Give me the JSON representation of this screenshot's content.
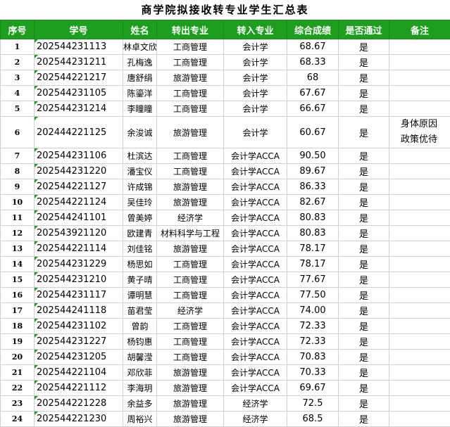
{
  "title": "商学院拟接收转专业学生汇总表",
  "headers": [
    "序号",
    "学号",
    "姓名",
    "转出专业",
    "转入专业",
    "综合成绩",
    "是否通过",
    "备注"
  ],
  "rows": [
    {
      "seq": "1",
      "id": "202544231113",
      "name": "林卓文欣",
      "from": "工商管理",
      "to": "会计学",
      "score": "68.67",
      "pass": "是",
      "note": ""
    },
    {
      "seq": "2",
      "id": "202544231211",
      "name": "孔梅逸",
      "from": "工商管理",
      "to": "会计学",
      "score": "68.33",
      "pass": "是",
      "note": ""
    },
    {
      "seq": "3",
      "id": "202544221217",
      "name": "唐舒绢",
      "from": "旅游管理",
      "to": "会计学",
      "score": "68",
      "pass": "是",
      "note": ""
    },
    {
      "seq": "4",
      "id": "202544231105",
      "name": "陈鎏洋",
      "from": "工商管理",
      "to": "会计学",
      "score": "67.67",
      "pass": "是",
      "note": ""
    },
    {
      "seq": "5",
      "id": "202544231214",
      "name": "李瞳瞳",
      "from": "工商管理",
      "to": "会计学",
      "score": "66.67",
      "pass": "是",
      "note": ""
    },
    {
      "seq": "6",
      "id": "202444221125",
      "name": "余浚诚",
      "from": "旅游管理",
      "to": "会计学",
      "score": "60.67",
      "pass": "是",
      "note": "身体原因\n政策优待"
    },
    {
      "seq": "7",
      "id": "202544231106",
      "name": "杜滨达",
      "from": "工商管理",
      "to": "会计学ACCA",
      "score": "90.50",
      "pass": "是",
      "note": ""
    },
    {
      "seq": "8",
      "id": "202544231220",
      "name": "潘宝仪",
      "from": "工商管理",
      "to": "会计学ACCA",
      "score": "89.67",
      "pass": "是",
      "note": ""
    },
    {
      "seq": "9",
      "id": "202544221127",
      "name": "许成锦",
      "from": "旅游管理",
      "to": "会计学ACCA",
      "score": "86.33",
      "pass": "是",
      "note": ""
    },
    {
      "seq": "10",
      "id": "202544221124",
      "name": "吴佳玲",
      "from": "旅游管理",
      "to": "会计学ACCA",
      "score": "82.67",
      "pass": "是",
      "note": ""
    },
    {
      "seq": "11",
      "id": "202544241101",
      "name": "曾美婷",
      "from": "经济学",
      "to": "会计学ACCA",
      "score": "80.83",
      "pass": "是",
      "note": ""
    },
    {
      "seq": "12",
      "id": "202543921120",
      "name": "欧建青",
      "from": "材料科学与工程",
      "to": "会计学ACCA",
      "score": "80.83",
      "pass": "是",
      "note": ""
    },
    {
      "seq": "13",
      "id": "202544221114",
      "name": "刘佳铭",
      "from": "旅游管理",
      "to": "会计学ACCA",
      "score": "78.17",
      "pass": "是",
      "note": ""
    },
    {
      "seq": "14",
      "id": "202544231229",
      "name": "杨思如",
      "from": "工商管理",
      "to": "会计学ACCA",
      "score": "78.17",
      "pass": "是",
      "note": ""
    },
    {
      "seq": "15",
      "id": "202544231210",
      "name": "黄子晴",
      "from": "工商管理",
      "to": "会计学ACCA",
      "score": "77.67",
      "pass": "是",
      "note": ""
    },
    {
      "seq": "16",
      "id": "202544231117",
      "name": "谭明慧",
      "from": "工商管理",
      "to": "会计学ACCA",
      "score": "77.50",
      "pass": "是",
      "note": ""
    },
    {
      "seq": "17",
      "id": "202544241118",
      "name": "苗君莹",
      "from": "经济学",
      "to": "会计学ACCA",
      "score": "74.00",
      "pass": "是",
      "note": ""
    },
    {
      "seq": "18",
      "id": "202544231102",
      "name": "曾韵",
      "from": "工商管理",
      "to": "会计学ACCA",
      "score": "72.33",
      "pass": "是",
      "note": ""
    },
    {
      "seq": "19",
      "id": "202544231227",
      "name": "杨钧惠",
      "from": "工商管理",
      "to": "会计学ACCA",
      "score": "72.33",
      "pass": "是",
      "note": ""
    },
    {
      "seq": "20",
      "id": "202544231205",
      "name": "胡馨滢",
      "from": "工商管理",
      "to": "会计学ACCA",
      "score": "70.83",
      "pass": "是",
      "note": ""
    },
    {
      "seq": "21",
      "id": "202544221104",
      "name": "邓欣菲",
      "from": "旅游管理",
      "to": "会计学ACCA",
      "score": "70.33",
      "pass": "是",
      "note": ""
    },
    {
      "seq": "22",
      "id": "202544221112",
      "name": "李海玥",
      "from": "旅游管理",
      "to": "会计学ACCA",
      "score": "69.67",
      "pass": "是",
      "note": ""
    },
    {
      "seq": "23",
      "id": "202544221228",
      "name": "余益多",
      "from": "旅游管理",
      "to": "经济学",
      "score": "72.5",
      "pass": "是",
      "note": ""
    },
    {
      "seq": "24",
      "id": "202544221230",
      "name": "周裕兴",
      "from": "旅游管理",
      "to": "经济学",
      "score": "68.5",
      "pass": "是",
      "note": ""
    }
  ]
}
